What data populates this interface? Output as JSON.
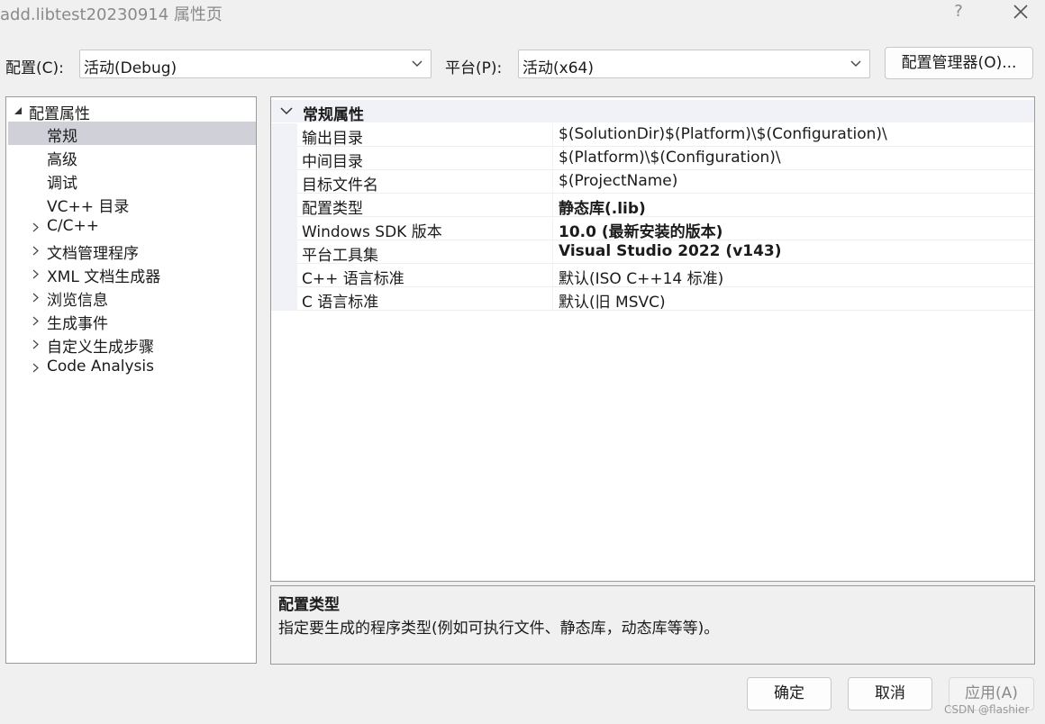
{
  "window": {
    "title": "add.libtest20230914 属性页",
    "help_glyph": "?",
    "close_icon": "close-icon"
  },
  "config_row": {
    "config_label": "配置(C):",
    "config_value": "活动(Debug)",
    "platform_label": "平台(P):",
    "platform_value": "活动(x64)",
    "manager_button": "配置管理器(O)..."
  },
  "tree": {
    "root": "配置属性",
    "items": [
      {
        "label": "常规",
        "selected": true,
        "expandable": false
      },
      {
        "label": "高级",
        "expandable": false
      },
      {
        "label": "调试",
        "expandable": false
      },
      {
        "label": "VC++ 目录",
        "expandable": false
      },
      {
        "label": "C/C++",
        "expandable": true
      },
      {
        "label": "文档管理程序",
        "expandable": true
      },
      {
        "label": "XML 文档生成器",
        "expandable": true
      },
      {
        "label": "浏览信息",
        "expandable": true
      },
      {
        "label": "生成事件",
        "expandable": true
      },
      {
        "label": "自定义生成步骤",
        "expandable": true
      },
      {
        "label": "Code Analysis",
        "expandable": true
      }
    ]
  },
  "properties": {
    "section": "常规属性",
    "rows": [
      {
        "name": "输出目录",
        "value": "$(SolutionDir)$(Platform)\\$(Configuration)\\",
        "bold": false
      },
      {
        "name": "中间目录",
        "value": "$(Platform)\\$(Configuration)\\",
        "bold": false
      },
      {
        "name": "目标文件名",
        "value": "$(ProjectName)",
        "bold": false
      },
      {
        "name": "配置类型",
        "value": "静态库(.lib)",
        "bold": true
      },
      {
        "name": "Windows SDK 版本",
        "value": "10.0 (最新安装的版本)",
        "bold": true
      },
      {
        "name": "平台工具集",
        "value": "Visual Studio 2022 (v143)",
        "bold": true
      },
      {
        "name": "C++ 语言标准",
        "value": "默认(ISO C++14 标准)",
        "bold": false
      },
      {
        "name": "C 语言标准",
        "value": "默认(旧 MSVC)",
        "bold": false
      }
    ]
  },
  "description": {
    "title": "配置类型",
    "text": "指定要生成的程序类型(例如可执行文件、静态库，动态库等等)。"
  },
  "buttons": {
    "ok": "确定",
    "cancel": "取消",
    "apply": "应用(A)"
  },
  "watermark": "CSDN @flashier",
  "colors": {
    "selection": "#cfd0d8",
    "section_bg": "#f0f2f7",
    "disabled_text": "#8a8a8a"
  }
}
